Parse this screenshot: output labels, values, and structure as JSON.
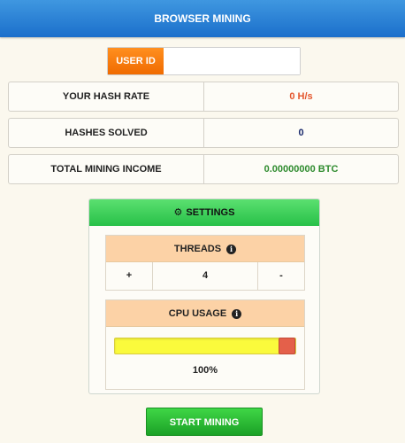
{
  "header": {
    "title": "BROWSER MINING"
  },
  "user": {
    "label": "USER ID",
    "value": "",
    "placeholder": ""
  },
  "stats": [
    {
      "label": "YOUR HASH RATE",
      "value": "0 H/s",
      "color": "#e4572e"
    },
    {
      "label": "HASHES SOLVED",
      "value": "0",
      "color": "#1a2a6c"
    },
    {
      "label": "TOTAL MINING INCOME",
      "value": "0.00000000 BTC",
      "color": "#2e8b2e"
    }
  ],
  "settings": {
    "title": "SETTINGS",
    "icon": "gear-icon",
    "threads": {
      "label": "THREADS",
      "value": "4",
      "plus": "+",
      "minus": "-"
    },
    "cpu": {
      "label": "CPU USAGE",
      "value": "100%",
      "level": 1.0
    },
    "info_glyph": "i"
  },
  "action": {
    "start_label": "START MINING"
  },
  "colors": {
    "header": "#2b7fd6",
    "user_id_bg": "#f57c00",
    "settings_head": "#36c84f",
    "panel_head": "#fcd2a6",
    "slider_fill": "#fafa3c",
    "slider_handle": "#e4604a",
    "start_button": "#22b02c"
  }
}
